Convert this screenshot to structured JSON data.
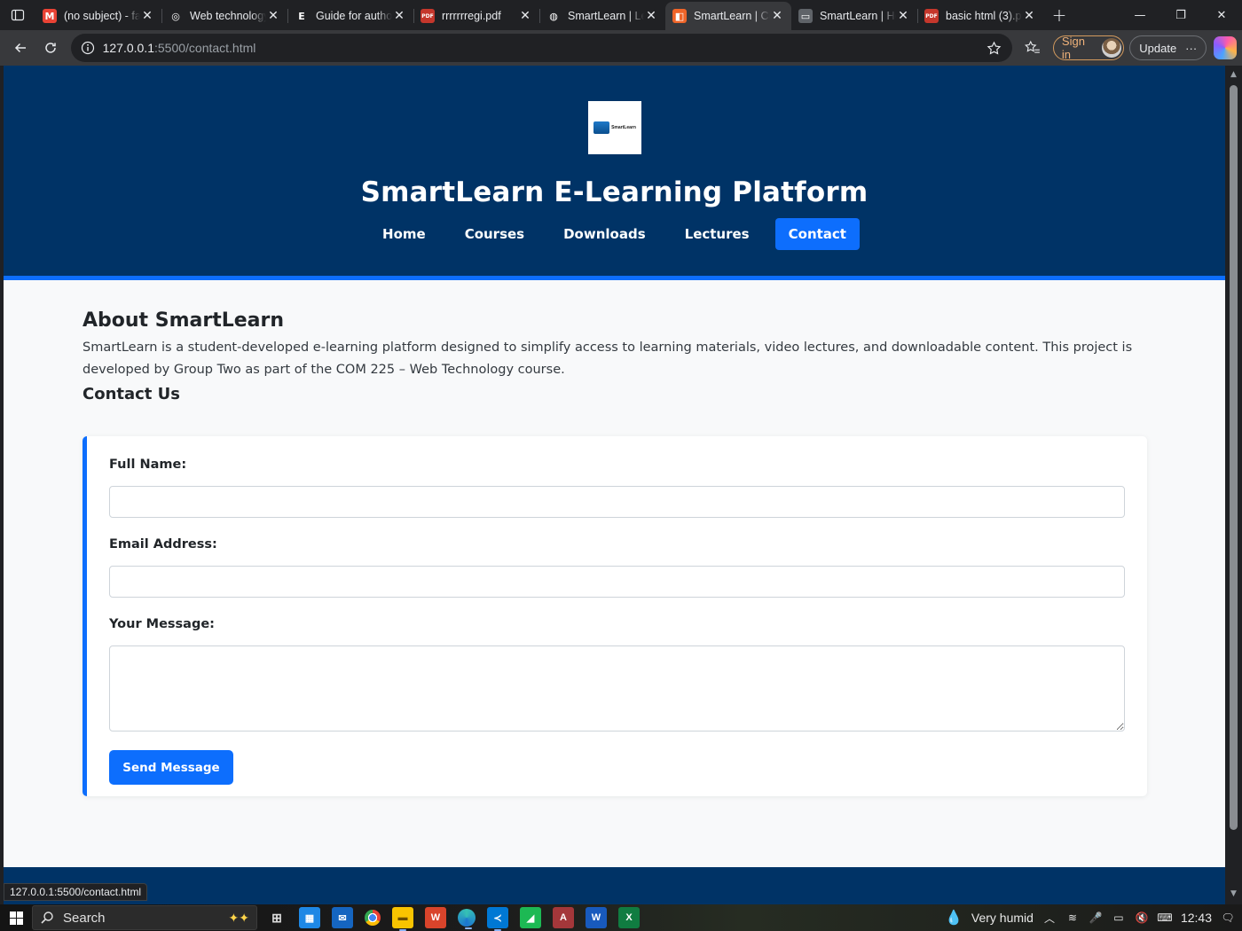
{
  "browser": {
    "tabs": [
      {
        "title": "(no subject) - fa",
        "favicon_color": "#ea4335",
        "favicon": "M",
        "active": false
      },
      {
        "title": "Web technology",
        "favicon_color": "#202124",
        "favicon": "◎",
        "active": false
      },
      {
        "title": "Guide for autho",
        "favicon_color": "#202124",
        "favicon": "E",
        "active": false
      },
      {
        "title": "rrrrrrregi.pdf",
        "favicon_color": "#c5372c",
        "favicon": "PDF",
        "active": false
      },
      {
        "title": "SmartLearn | Le",
        "favicon_color": "#202124",
        "favicon": "◍",
        "active": false
      },
      {
        "title": "SmartLearn | Co",
        "favicon_color": "#f06529",
        "favicon": "◧",
        "active": true
      },
      {
        "title": "SmartLearn | Ho",
        "favicon_color": "#5f6368",
        "favicon": "▭",
        "active": false
      },
      {
        "title": "basic html (3).pdf",
        "favicon_color": "#c5372c",
        "favicon": "PDF",
        "active": false
      }
    ],
    "url_host": "127.0.0.1",
    "url_rest": ":5500/contact.html",
    "signin_label": "Sign in",
    "update_label": "Update",
    "status_url": "127.0.0.1:5500/contact.html"
  },
  "site": {
    "logo_text": "SmartLearn",
    "title": "SmartLearn E-Learning Platform",
    "nav": [
      {
        "label": "Home",
        "active": false
      },
      {
        "label": "Courses",
        "active": false
      },
      {
        "label": "Downloads",
        "active": false
      },
      {
        "label": "Lectures",
        "active": false
      },
      {
        "label": "Contact",
        "active": true
      }
    ],
    "about_heading": "About SmartLearn",
    "about_text": "SmartLearn is a student-developed e-learning platform designed to simplify access to learning materials, video lectures, and downloadable content. This project is developed by Group Two as part of the COM 225 – Web Technology course.",
    "contact_heading": "Contact Us",
    "form": {
      "name_label": "Full Name:",
      "name_value": "",
      "email_label": "Email Address:",
      "email_value": "",
      "message_label": "Your Message:",
      "message_value": "",
      "submit_label": "Send Message"
    }
  },
  "taskbar": {
    "search_label": "Search",
    "weather": "Very humid",
    "time": "12:43"
  },
  "colors": {
    "header_bg": "#003366",
    "accent": "#0d6efd"
  }
}
